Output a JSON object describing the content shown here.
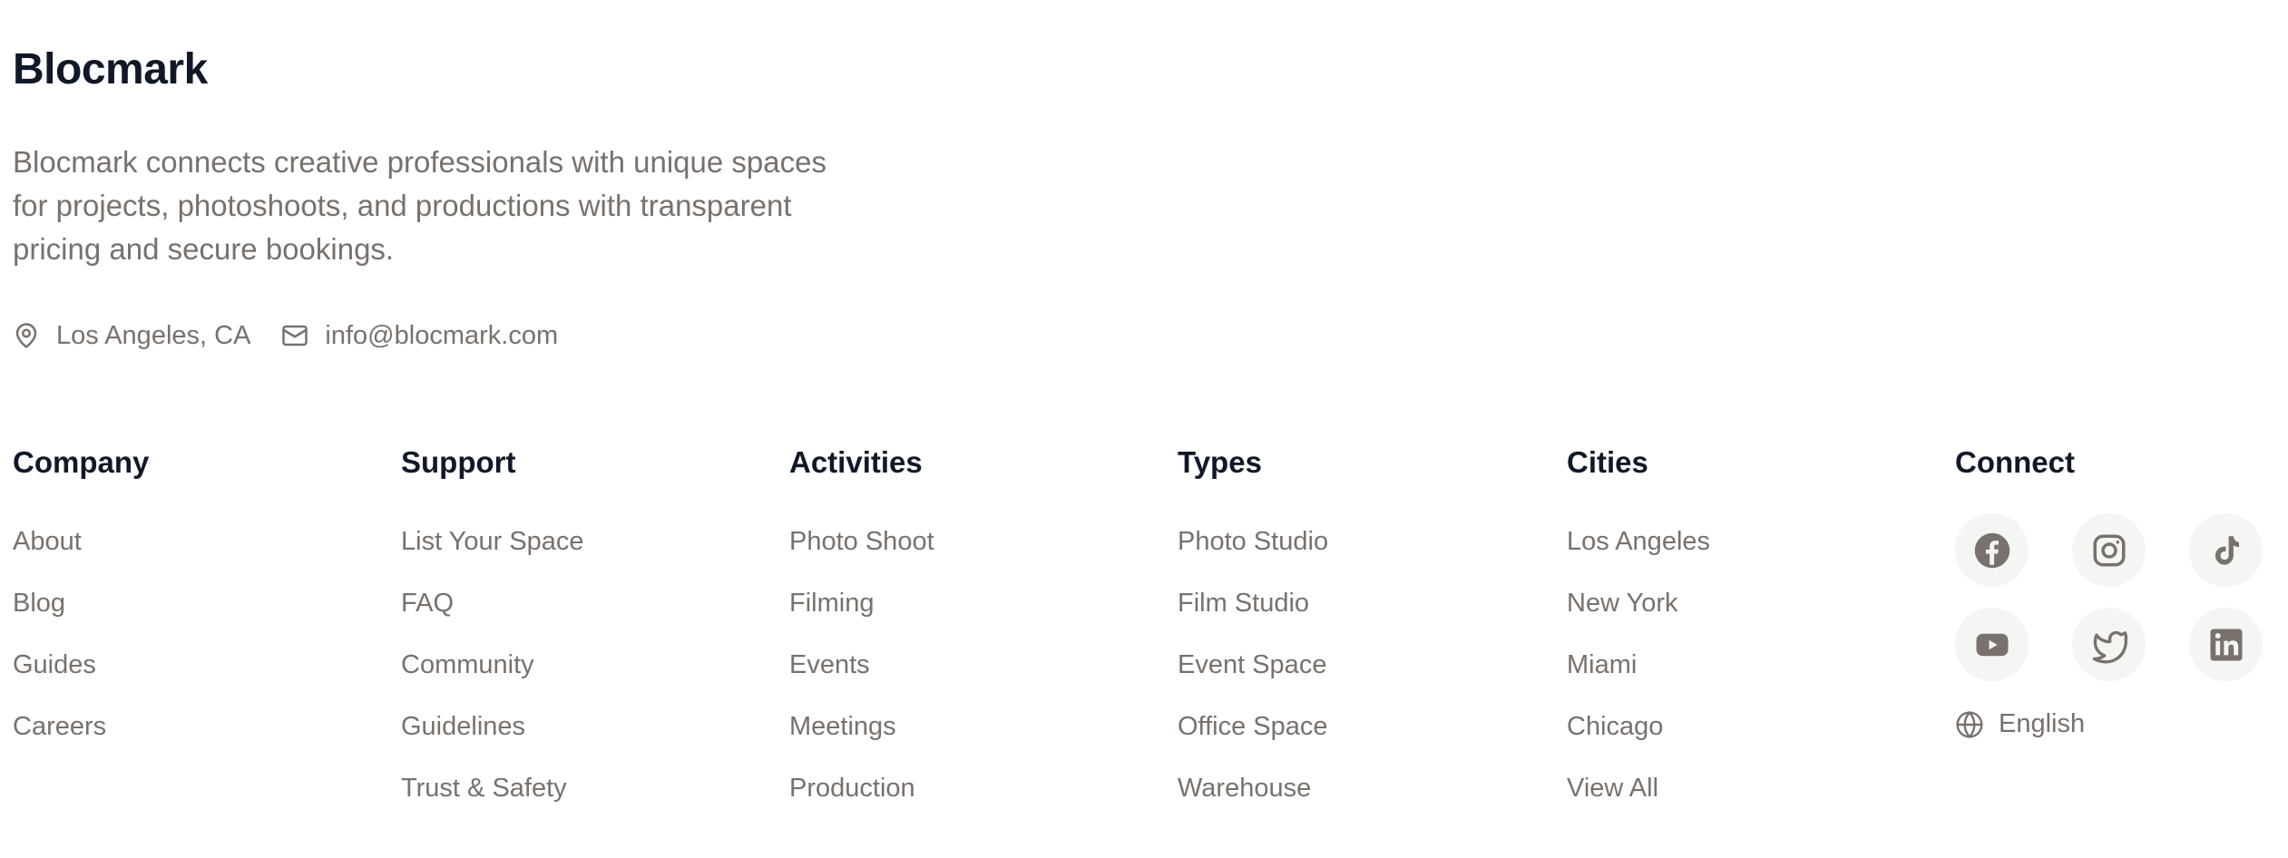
{
  "brand": {
    "name": "Blocmark",
    "description": "Blocmark connects creative professionals with unique spaces for projects, photoshoots, and productions with transparent pricing and secure bookings."
  },
  "contact": {
    "location": "Los Angeles, CA",
    "location_icon": "map-pin-icon",
    "email": "info@blocmark.com",
    "email_icon": "mail-icon"
  },
  "columns": {
    "company": {
      "title": "Company",
      "links": [
        "About",
        "Blog",
        "Guides",
        "Careers"
      ]
    },
    "support": {
      "title": "Support",
      "links": [
        "List Your Space",
        "FAQ",
        "Community",
        "Guidelines",
        "Trust & Safety"
      ]
    },
    "activities": {
      "title": "Activities",
      "links": [
        "Photo Shoot",
        "Filming",
        "Events",
        "Meetings",
        "Production"
      ]
    },
    "types": {
      "title": "Types",
      "links": [
        "Photo Studio",
        "Film Studio",
        "Event Space",
        "Office Space",
        "Warehouse"
      ]
    },
    "cities": {
      "title": "Cities",
      "links": [
        "Los Angeles",
        "New York",
        "Miami",
        "Chicago",
        "View All"
      ]
    }
  },
  "connect": {
    "title": "Connect",
    "social_icons": [
      "facebook-icon",
      "instagram-icon",
      "tiktok-icon",
      "youtube-icon",
      "twitter-icon",
      "linkedin-icon"
    ],
    "language": "English",
    "language_icon": "globe-icon"
  },
  "colors": {
    "heading": "#111827",
    "text_muted": "#78716c",
    "icon_bg": "#f5f5f4",
    "icon_fg": "#78716c"
  }
}
